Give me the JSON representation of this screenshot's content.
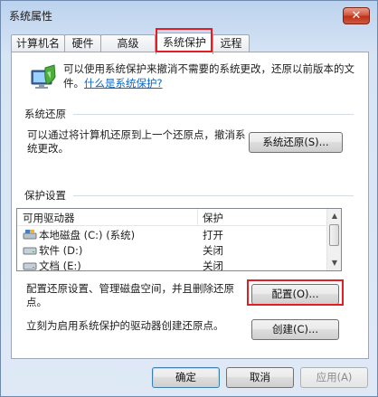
{
  "window": {
    "title": "系统属性",
    "close_glyph": "✕"
  },
  "tabs": [
    {
      "label": "计算机名"
    },
    {
      "label": "硬件"
    },
    {
      "label": "高级"
    },
    {
      "label": "系统保护",
      "active": true
    },
    {
      "label": "远程"
    }
  ],
  "intro": {
    "text": "可以使用系统保护来撤消不需要的系统更改，还原以前版本的文件。",
    "link": "什么是系统保护?"
  },
  "restore": {
    "section_label": "系统还原",
    "description": "可以通过将计算机还原到上一个还原点，撤消系统更改。",
    "button_label": "系统还原(S)..."
  },
  "protection": {
    "section_label": "保护设置",
    "columns": [
      "可用驱动器",
      "保护"
    ],
    "drives": [
      {
        "name": "本地磁盘 (C:) (系统)",
        "protection": "打开",
        "icon": "system-drive-icon"
      },
      {
        "name": "软件 (D:)",
        "protection": "关闭",
        "icon": "drive-icon"
      },
      {
        "name": "文档 (E:)",
        "protection": "关闭",
        "icon": "drive-icon"
      }
    ],
    "configure_text": "配置还原设置、管理磁盘空间，并且删除还原点。",
    "configure_button": "配置(O)...",
    "create_text": "立刻为启用系统保护的驱动器创建还原点。",
    "create_button": "创建(C)..."
  },
  "footer": {
    "ok": "确定",
    "cancel": "取消",
    "apply": "应用(A)"
  },
  "colors": {
    "highlight": "#e21e24",
    "link": "#0b66c8"
  }
}
